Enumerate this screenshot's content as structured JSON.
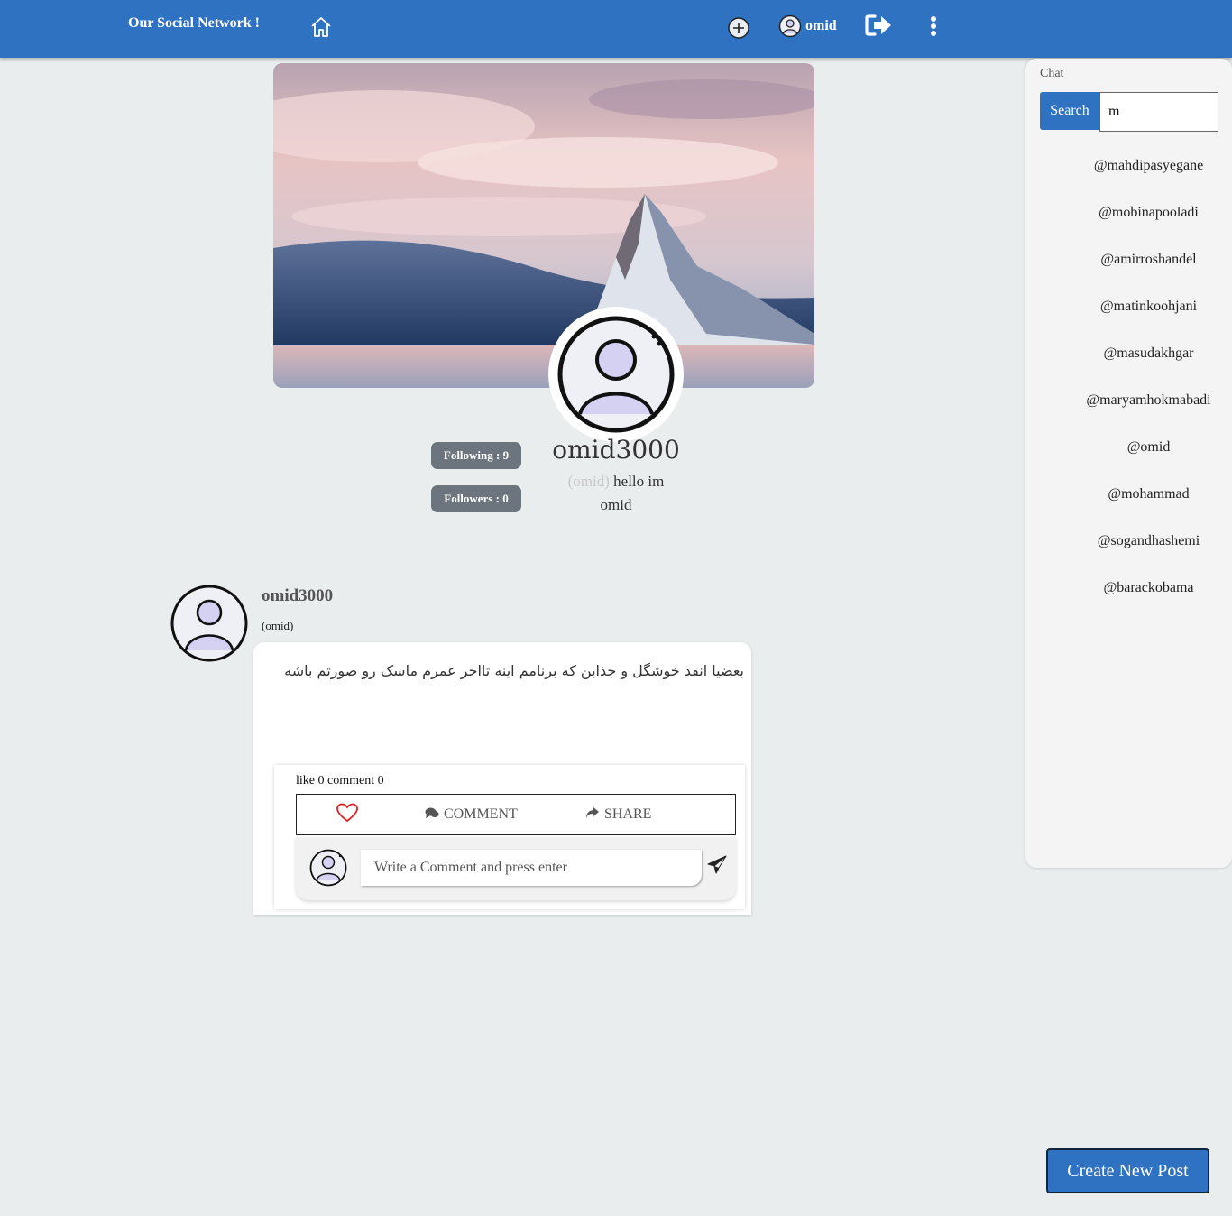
{
  "navbar": {
    "brand": "Our Social Network !",
    "home_icon": "home-icon",
    "add_icon": "plus-circle-icon",
    "user_name": "omid",
    "user_icon": "user-circle-icon",
    "logout_icon": "logout-icon",
    "more_icon": "more-vertical-icon"
  },
  "profile": {
    "username": "omid3000",
    "nickname": "(omid)",
    "bio": "hello im omid",
    "following_label": "Following : 9",
    "followers_label": "Followers : 0"
  },
  "post": {
    "author": "omid3000",
    "nickname": "(omid)",
    "text": "بعضیا انقد خوشگل و جذابن که برنامم اینه تااخر عمرم ماسک رو صورتم باشه",
    "counts": "like 0 comment 0",
    "comment_label": "COMMENT",
    "share_label": "SHARE",
    "comment_placeholder": "Write a Comment and press enter"
  },
  "chat": {
    "title": "Chat",
    "search_label": "Search",
    "search_value": "m",
    "users": [
      "@mahdipasyegane",
      "@mobinapooladi",
      "@amirroshandel",
      "@matinkoohjani",
      "@masudakhgar",
      "@maryamhokmabadi",
      "@omid",
      "@mohammad",
      "@sogandhashemi",
      "@barackobama"
    ]
  },
  "create_post_label": "Create New Post",
  "colors": {
    "primary": "#2e72c1",
    "background": "#e9edee",
    "pill": "#6c757d",
    "like": "#e02020"
  }
}
